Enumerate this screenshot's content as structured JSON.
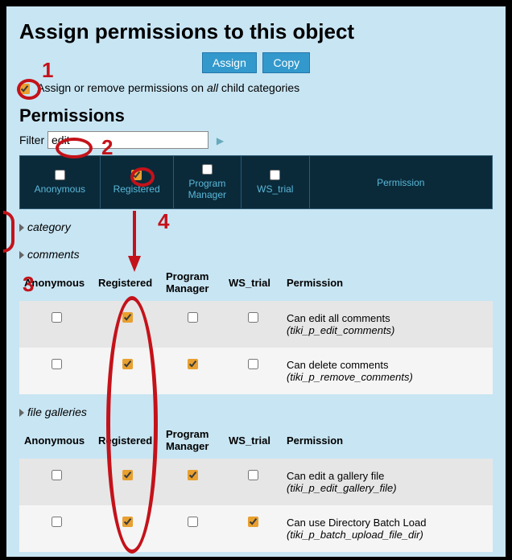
{
  "title": "Assign permissions to this object",
  "buttons": {
    "assign": "Assign",
    "copy": "Copy"
  },
  "child_option": {
    "prefix": "Assign or remove permissions on ",
    "italic": "all",
    "suffix": " child categories",
    "checked": true
  },
  "permissions_heading": "Permissions",
  "filter": {
    "label": "Filter",
    "value": "edit"
  },
  "header_cols": [
    {
      "label": "Anonymous",
      "checked": false
    },
    {
      "label": "Registered",
      "checked": true
    },
    {
      "label": "Program Manager",
      "checked": false
    },
    {
      "label": "WS_trial",
      "checked": false
    }
  ],
  "header_perm": "Permission",
  "sections": [
    {
      "name": "category",
      "expanded": false,
      "rows": []
    },
    {
      "name": "comments",
      "expanded": true,
      "cols": [
        "Anonymous",
        "Registered",
        "Program Manager",
        "WS_trial",
        "Permission"
      ],
      "rows": [
        {
          "cells": [
            false,
            true,
            false,
            false
          ],
          "desc": "Can edit all comments",
          "perm": "(tiki_p_edit_comments)"
        },
        {
          "cells": [
            false,
            true,
            true,
            false
          ],
          "desc": "Can delete comments",
          "perm": "(tiki_p_remove_comments)"
        }
      ]
    },
    {
      "name": "file galleries",
      "expanded": true,
      "cols": [
        "Anonymous",
        "Registered",
        "Program Manager",
        "WS_trial",
        "Permission"
      ],
      "rows": [
        {
          "cells": [
            false,
            true,
            true,
            false
          ],
          "desc": "Can edit a gallery file",
          "perm": "(tiki_p_edit_gallery_file)"
        },
        {
          "cells": [
            false,
            true,
            false,
            true
          ],
          "desc": "Can use Directory Batch Load",
          "perm": "(tiki_p_batch_upload_file_dir)"
        }
      ]
    }
  ],
  "annotations": [
    "1",
    "2",
    "3",
    "4"
  ]
}
